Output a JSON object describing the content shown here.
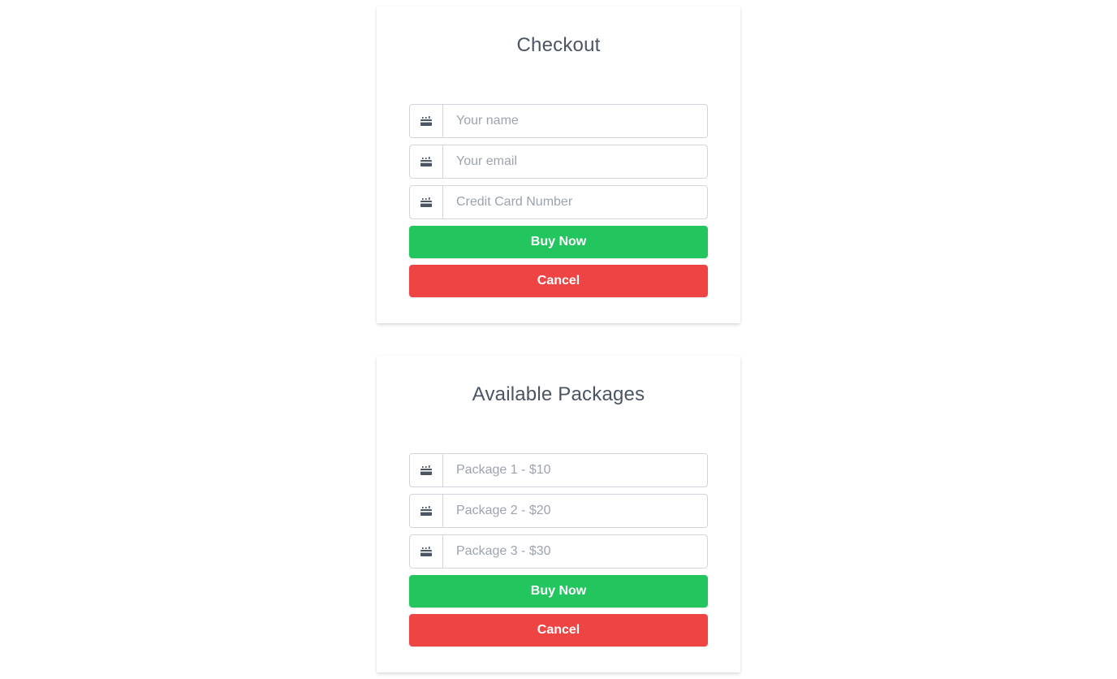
{
  "checkout": {
    "title": "Checkout",
    "fields": [
      {
        "placeholder": "Your name",
        "icon": "credit-card-icon"
      },
      {
        "placeholder": "Your email",
        "icon": "credit-card-icon"
      },
      {
        "placeholder": "Credit Card Number",
        "icon": "credit-card-icon"
      }
    ],
    "buy_label": "Buy Now",
    "cancel_label": "Cancel"
  },
  "packages": {
    "title": "Available Packages",
    "fields": [
      {
        "placeholder": "Package 1 - $10",
        "icon": "credit-card-icon"
      },
      {
        "placeholder": "Package 2 - $20",
        "icon": "credit-card-icon"
      },
      {
        "placeholder": "Package 3 - $30",
        "icon": "credit-card-icon"
      }
    ],
    "buy_label": "Buy Now",
    "cancel_label": "Cancel"
  },
  "colors": {
    "buy": "#22c55e",
    "cancel": "#ef4444",
    "title": "#4b5563",
    "icon": "#4b5563"
  }
}
